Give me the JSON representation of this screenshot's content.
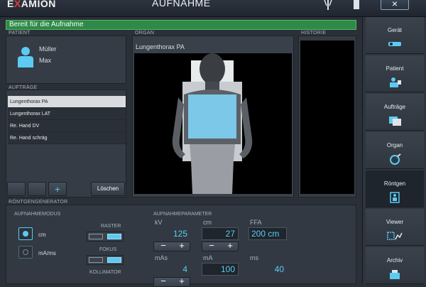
{
  "app": {
    "logo_prefix": "E",
    "logo_x": "X",
    "logo_suffix": "AMION",
    "title": "AUFNAHME",
    "close_label": "×"
  },
  "status": {
    "text": "Bereit für die Aufnahme",
    "color": "#2f8a48"
  },
  "patient": {
    "section_label": "PATIENT",
    "last_name": "Müller",
    "first_name": "Max"
  },
  "organ": {
    "section_label": "ORGAN",
    "title": "Lungenthorax PA"
  },
  "history": {
    "section_label": "HISTORIE"
  },
  "orders": {
    "section_label": "AUFTRÄGE",
    "items": [
      "Lungenthorax PA",
      "Lungenthorax LAT",
      "Re. Hand DV",
      "Re. Hand schräg"
    ],
    "selected_index": 0,
    "add_label": "+",
    "delete_label": "Löschen"
  },
  "generator": {
    "section_label": "RÖNTGENGENERATOR",
    "mode_label": "AUFNAHMEMODUS",
    "mode_options": [
      "cm",
      "mA/ms"
    ],
    "mode_selected": "cm",
    "raster_label": "RASTER",
    "fokus_label": "FOKUS",
    "kollimator_label": "KOLLIMATOR",
    "params_label": "AUFNAHMEPARAMETER",
    "kv_label": "kV",
    "kv_value": "125",
    "cm_label": "cm",
    "cm_value": "27",
    "ffa_label": "FFA",
    "ffa_value": "200 cm",
    "mas_label": "mAs",
    "mas_value": "4",
    "ma_label": "mA",
    "ma_value": "100",
    "ms_label": "ms",
    "ms_value": "40",
    "minus": "−",
    "plus": "+"
  },
  "nav": {
    "items": [
      {
        "label": "Gerät",
        "icon": "device-icon"
      },
      {
        "label": "Patient",
        "icon": "patient-icon"
      },
      {
        "label": "Aufträge",
        "icon": "orders-icon"
      },
      {
        "label": "Organ",
        "icon": "organ-icon"
      },
      {
        "label": "Röntgen",
        "icon": "xray-icon"
      },
      {
        "label": "Viewer",
        "icon": "viewer-icon"
      },
      {
        "label": "Archiv",
        "icon": "archive-icon"
      }
    ],
    "active": "Röntgen",
    "accent": "#5ccaf2"
  }
}
